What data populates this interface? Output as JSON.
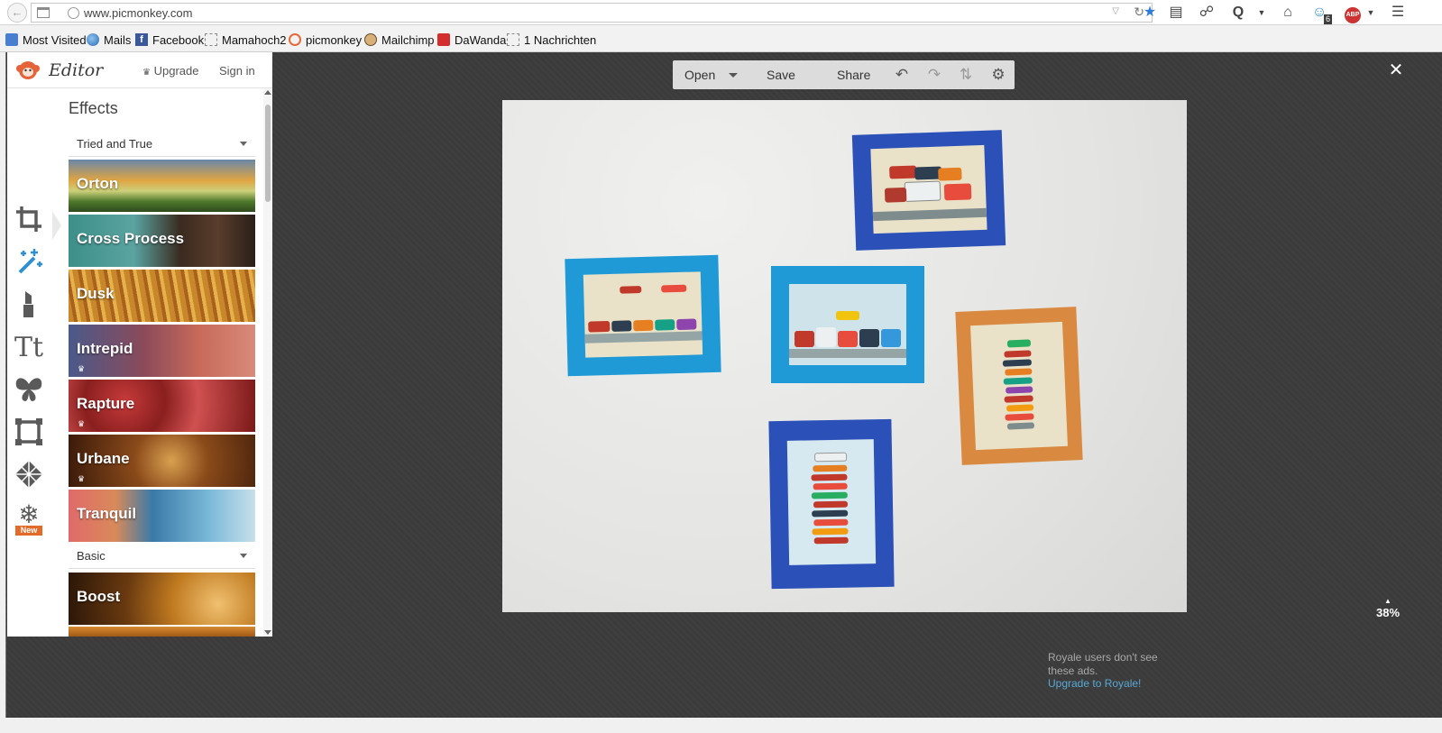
{
  "browser": {
    "url": "www.picmonkey.com",
    "toolbar_icons": [
      "back-icon",
      "tab-grid-icon",
      "bookmark-star-icon",
      "reading-list-icon",
      "share-icon",
      "extension-q-icon",
      "home-icon",
      "ghostery-icon",
      "adblock-plus-icon",
      "hamburger-menu-icon"
    ],
    "ghostery_count": "6",
    "adblock_label": "ABP",
    "bookmarks": [
      {
        "label": "Most Visited",
        "icon": "most-visited-icon"
      },
      {
        "label": "Mails",
        "icon": "globe-icon"
      },
      {
        "label": "Facebook",
        "icon": "facebook-icon"
      },
      {
        "label": "Mamahoch2",
        "icon": "blank-page-icon"
      },
      {
        "label": "picmonkey",
        "icon": "picmonkey-icon"
      },
      {
        "label": "Mailchimp",
        "icon": "mailchimp-icon"
      },
      {
        "label": "DaWanda",
        "icon": "dawanda-icon"
      },
      {
        "label": "1 Nachrichten",
        "icon": "blank-page-icon"
      }
    ]
  },
  "editor": {
    "title": "Editor",
    "upgrade_label": "Upgrade",
    "signin_label": "Sign in",
    "section_title": "Effects",
    "tools": [
      "crop-icon",
      "effects-wand-icon",
      "touch-up-lipstick-icon",
      "text-icon",
      "overlays-butterfly-icon",
      "frames-icon",
      "textures-icon",
      "seasonal-snowflake-icon"
    ],
    "active_tool": "effects-wand-icon",
    "new_badge": "New",
    "groups": [
      {
        "name": "Tried and True",
        "effects": [
          {
            "label": "Orton",
            "premium": false
          },
          {
            "label": "Cross Process",
            "premium": false
          },
          {
            "label": "Dusk",
            "premium": false
          },
          {
            "label": "Intrepid",
            "premium": true
          },
          {
            "label": "Rapture",
            "premium": true
          },
          {
            "label": "Urbane",
            "premium": true
          },
          {
            "label": "Tranquil",
            "premium": false
          }
        ]
      },
      {
        "name": "Basic",
        "effects": [
          {
            "label": "Boost",
            "premium": false
          }
        ]
      }
    ]
  },
  "toolbar": {
    "open_label": "Open",
    "save_label": "Save",
    "share_label": "Share",
    "icons": [
      "undo-icon",
      "redo-icon",
      "history-icon",
      "settings-gear-icon"
    ]
  },
  "canvas": {
    "zoom": "38%",
    "ad_note": "Royale users don't see these ads.",
    "ad_link": "Upgrade to Royale!"
  },
  "colors": {
    "workspace_bg": "#3b3b3b",
    "accent_blue": "#2f8fd0",
    "frame_dark_blue": "#2b50b8",
    "frame_light_blue": "#1f9ad6",
    "frame_orange": "#d98a40",
    "new_badge": "#e26b2a"
  }
}
